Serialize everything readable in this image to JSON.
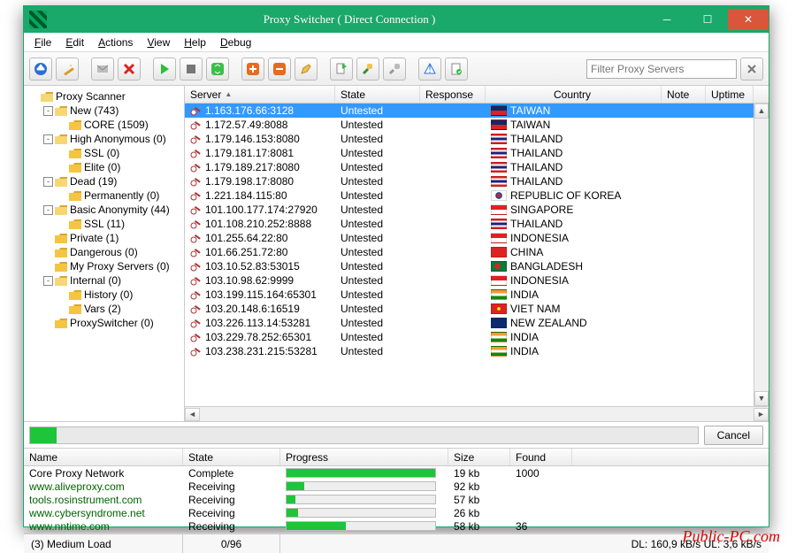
{
  "window": {
    "title": "Proxy Switcher ( Direct Connection )"
  },
  "menu": [
    "File",
    "Edit",
    "Actions",
    "View",
    "Help",
    "Debug"
  ],
  "filter": {
    "placeholder": "Filter Proxy Servers"
  },
  "tree": [
    {
      "d": 0,
      "pm": "",
      "label": "Proxy Scanner",
      "open": true
    },
    {
      "d": 1,
      "pm": "-",
      "label": "New (743)",
      "open": true
    },
    {
      "d": 2,
      "pm": "",
      "label": "CORE (1509)"
    },
    {
      "d": 1,
      "pm": "-",
      "label": "High Anonymous (0)",
      "open": true
    },
    {
      "d": 2,
      "pm": "",
      "label": "SSL (0)"
    },
    {
      "d": 2,
      "pm": "",
      "label": "Elite (0)"
    },
    {
      "d": 1,
      "pm": "-",
      "label": "Dead (19)",
      "open": true
    },
    {
      "d": 2,
      "pm": "",
      "label": "Permanently (0)"
    },
    {
      "d": 1,
      "pm": "-",
      "label": "Basic Anonymity (44)",
      "open": true
    },
    {
      "d": 2,
      "pm": "",
      "label": "SSL (11)"
    },
    {
      "d": 1,
      "pm": "",
      "label": "Private (1)"
    },
    {
      "d": 1,
      "pm": "",
      "label": "Dangerous (0)"
    },
    {
      "d": 1,
      "pm": "",
      "label": "My Proxy Servers (0)"
    },
    {
      "d": 1,
      "pm": "-",
      "label": "Internal (0)",
      "open": true
    },
    {
      "d": 2,
      "pm": "",
      "label": "History (0)"
    },
    {
      "d": 2,
      "pm": "",
      "label": "Vars (2)"
    },
    {
      "d": 1,
      "pm": "",
      "label": "ProxySwitcher (0)"
    }
  ],
  "columns": {
    "server": "Server",
    "state": "State",
    "response": "Response",
    "country": "Country",
    "note": "Note",
    "uptime": "Uptime"
  },
  "rows": [
    {
      "server": "1.163.176.66:3128",
      "state": "Untested",
      "country": "TAIWAN",
      "flag": "tw",
      "sel": true
    },
    {
      "server": "1.172.57.49:8088",
      "state": "Untested",
      "country": "TAIWAN",
      "flag": "tw"
    },
    {
      "server": "1.179.146.153:8080",
      "state": "Untested",
      "country": "THAILAND",
      "flag": "th"
    },
    {
      "server": "1.179.181.17:8081",
      "state": "Untested",
      "country": "THAILAND",
      "flag": "th"
    },
    {
      "server": "1.179.189.217:8080",
      "state": "Untested",
      "country": "THAILAND",
      "flag": "th"
    },
    {
      "server": "1.179.198.17:8080",
      "state": "Untested",
      "country": "THAILAND",
      "flag": "th"
    },
    {
      "server": "1.221.184.115:80",
      "state": "Untested",
      "country": "REPUBLIC OF KOREA",
      "flag": "kr"
    },
    {
      "server": "101.100.177.174:27920",
      "state": "Untested",
      "country": "SINGAPORE",
      "flag": "sg"
    },
    {
      "server": "101.108.210.252:8888",
      "state": "Untested",
      "country": "THAILAND",
      "flag": "th"
    },
    {
      "server": "101.255.64.22:80",
      "state": "Untested",
      "country": "INDONESIA",
      "flag": "id"
    },
    {
      "server": "101.66.251.72:80",
      "state": "Untested",
      "country": "CHINA",
      "flag": "cn"
    },
    {
      "server": "103.10.52.83:53015",
      "state": "Untested",
      "country": "BANGLADESH",
      "flag": "bd"
    },
    {
      "server": "103.10.98.62:9999",
      "state": "Untested",
      "country": "INDONESIA",
      "flag": "id"
    },
    {
      "server": "103.199.115.164:65301",
      "state": "Untested",
      "country": "INDIA",
      "flag": "in"
    },
    {
      "server": "103.20.148.6:16519",
      "state": "Untested",
      "country": "VIET NAM",
      "flag": "vn"
    },
    {
      "server": "103.226.113.14:53281",
      "state": "Untested",
      "country": "NEW ZEALAND",
      "flag": "nz"
    },
    {
      "server": "103.229.78.252:65301",
      "state": "Untested",
      "country": "INDIA",
      "flag": "in"
    },
    {
      "server": "103.238.231.215:53281",
      "state": "Untested",
      "country": "INDIA",
      "flag": "in"
    }
  ],
  "progress": {
    "pct": 4,
    "cancel": "Cancel"
  },
  "src_cols": {
    "name": "Name",
    "state": "State",
    "progress": "Progress",
    "size": "Size",
    "found": "Found"
  },
  "sources": [
    {
      "name": "Core Proxy Network",
      "link": false,
      "state": "Complete",
      "prog": 100,
      "size": "19 kb",
      "found": "1000"
    },
    {
      "name": "www.aliveproxy.com",
      "link": true,
      "state": "Receiving",
      "prog": 12,
      "size": "92 kb",
      "found": ""
    },
    {
      "name": "tools.rosinstrument.com",
      "link": true,
      "state": "Receiving",
      "prog": 6,
      "size": "57 kb",
      "found": ""
    },
    {
      "name": "www.cybersyndrome.net",
      "link": true,
      "state": "Receiving",
      "prog": 8,
      "size": "26 kb",
      "found": ""
    },
    {
      "name": "www.nntime.com",
      "link": true,
      "state": "Receiving",
      "prog": 40,
      "size": "58 kb",
      "found": "36"
    }
  ],
  "status": {
    "load": "(3) Medium Load",
    "ratio": "0/96",
    "net": "DL: 160,9 kB/s UL: 3,6 kB/s"
  },
  "watermark": "Public-PC.com"
}
